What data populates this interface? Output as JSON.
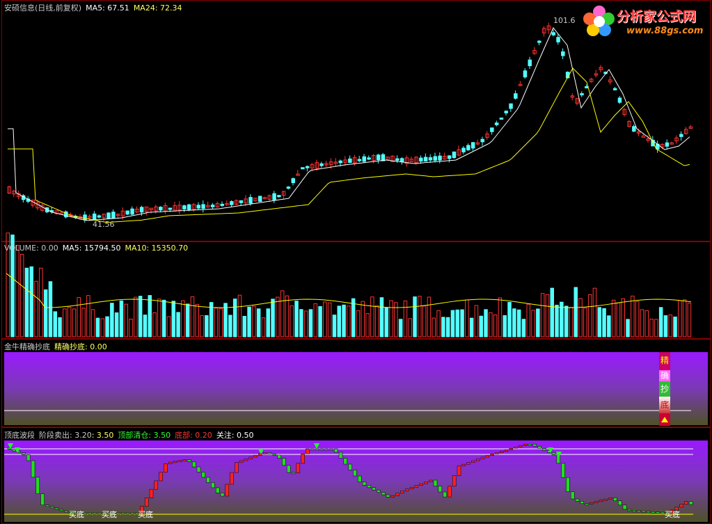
{
  "colors": {
    "up": "#ff3232",
    "down": "#54ffff",
    "ma1": "#ffffff",
    "ma2": "#ffff00",
    "label": "#c8c8c8",
    "purple": "#9a19ff"
  },
  "price": {
    "title": "安硕信息(日线,前复权)",
    "ma5_label": "MA5: 67.51",
    "ma24_label": "MA24: 72.34",
    "high_label": "101.6",
    "low_label": "41.56"
  },
  "volume": {
    "title": "VOLUME: 0.00",
    "ma5_label": "MA5: 15794.50",
    "ma10_label": "MA10: 15350.70"
  },
  "indicator1": {
    "title": "金牛精确抄底",
    "value_label": "精确抄底: 0.00",
    "chars": [
      "精",
      "确",
      "抄",
      "底"
    ]
  },
  "indicator2": {
    "title": "顶底波段",
    "sell_label": "阶段卖出: 3.20",
    "sell_value": ": 3.50",
    "clear_label": "顶部清仓: 3.50",
    "bottom_label": "底部: 0.20",
    "watch_label": "关注: 0.50",
    "buy_tag": "买底"
  },
  "logo": {
    "name": "分析家公式网",
    "url": "www.88gs.com"
  }
}
